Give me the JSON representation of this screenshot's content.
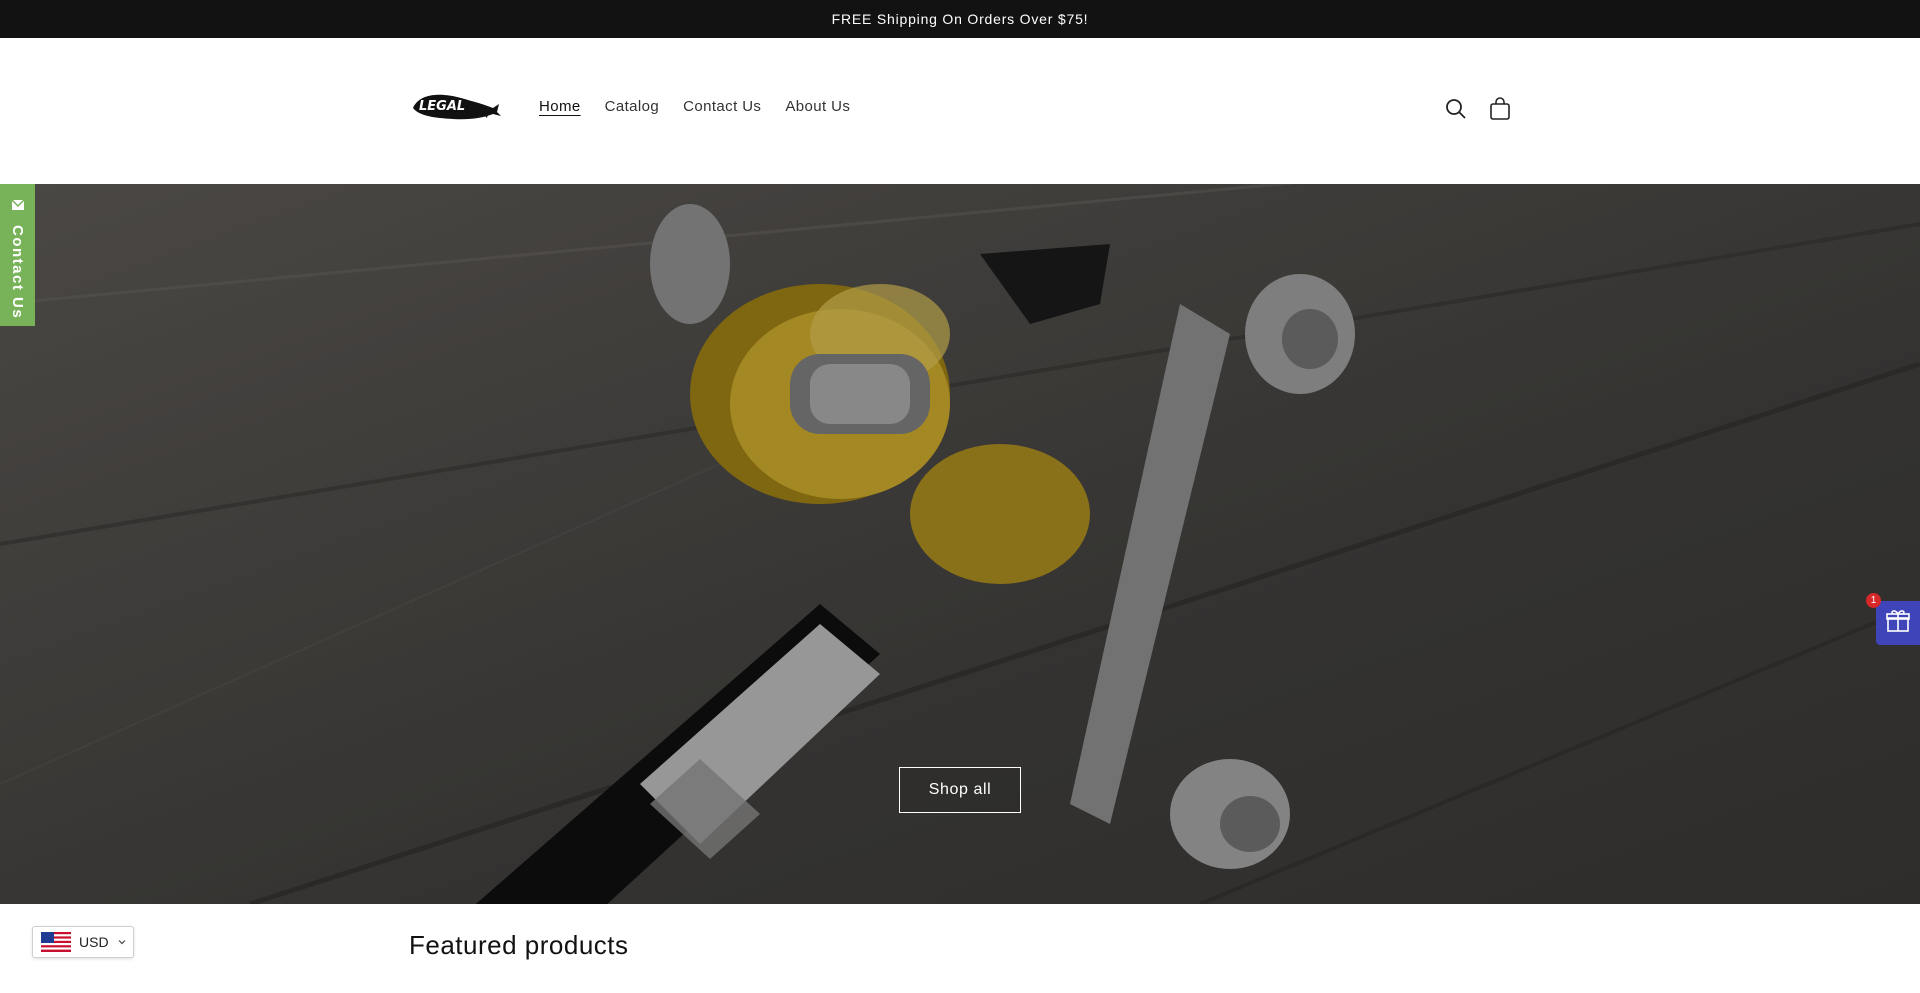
{
  "announcement": {
    "text": "FREE Shipping On Orders Over $75!"
  },
  "header": {
    "nav": [
      {
        "label": "Home",
        "active": true
      },
      {
        "label": "Catalog",
        "active": false
      },
      {
        "label": "Contact Us",
        "active": false
      },
      {
        "label": "About Us",
        "active": false
      }
    ],
    "icons": [
      "search-icon",
      "cart-icon"
    ],
    "logo_text": "LEGAL"
  },
  "hero": {
    "button_label": "Shop all"
  },
  "contact_tab": {
    "label": "Contact Us",
    "color": "#78b35a"
  },
  "gift_widget": {
    "badge_count": "1",
    "color": "#3f44b8"
  },
  "featured": {
    "title": "Featured products"
  },
  "currency": {
    "code": "USD"
  }
}
